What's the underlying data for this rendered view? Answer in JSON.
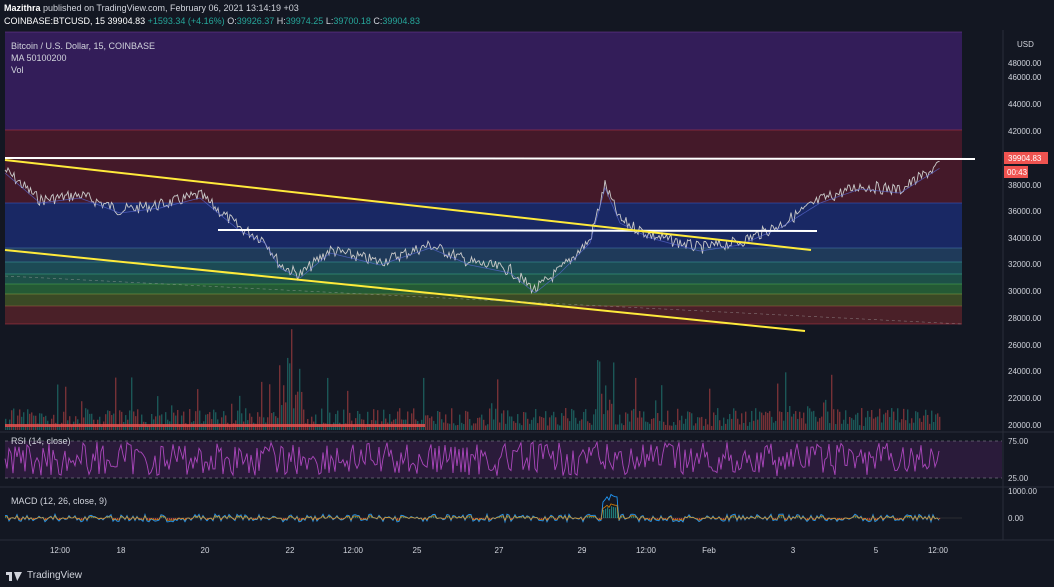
{
  "header": {
    "publisher": "Mazithra",
    "published_text": "published on TradingView.com, February 06, 2021 13:14:19 +03",
    "symbol": "COINBASE:BTCUSD, 15",
    "last_price": "39904.83",
    "change": "+1593.34 (+4.16%)",
    "ohlc": {
      "o_label": "O:",
      "o": "39926.37",
      "h_label": "H:",
      "h": "39974.25",
      "l_label": "L:",
      "l": "39700.18",
      "c_label": "C:",
      "c": "39904.83"
    }
  },
  "legend": {
    "title": "Bitcoin / U.S. Dollar, 15, COINBASE",
    "ma": "MA 50100200",
    "vol": "Vol"
  },
  "price_axis": {
    "currency": "USD",
    "ticks": [
      "48000.00",
      "46000.00",
      "44000.00",
      "42000.00",
      "38000.00",
      "36000.00",
      "34000.00",
      "32000.00",
      "30000.00",
      "28000.00",
      "26000.00",
      "24000.00",
      "22000.00",
      "20000.00"
    ],
    "current_price_label": "39904.83",
    "countdown_label": "00:43"
  },
  "rsi": {
    "label": "RSI (14, close)",
    "ticks": [
      "75.00",
      "25.00"
    ]
  },
  "macd": {
    "label": "MACD (12, 26, close, 9)",
    "ticks": [
      "1000.00",
      "0.00"
    ]
  },
  "time_axis": {
    "ticks": [
      "12:00",
      "18",
      "20",
      "22",
      "12:00",
      "25",
      "27",
      "29",
      "12:00",
      "Feb",
      "3",
      "5",
      "12:00"
    ]
  },
  "footer": {
    "brand": "TradingView"
  },
  "colors": {
    "background": "#131722",
    "candle_up": "#26a69a",
    "candle_down": "#ef5350",
    "trendline_yellow": "#ffeb3b",
    "support_white": "#ffffff",
    "rsi_purple": "#9c27b0"
  }
}
